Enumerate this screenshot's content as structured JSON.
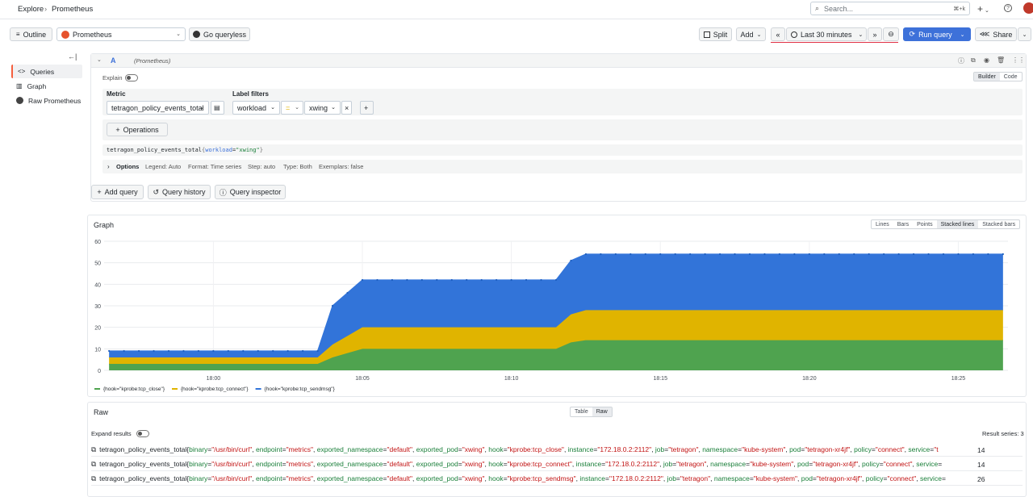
{
  "topbar": {
    "breadcrumb": [
      "Explore",
      "Prometheus"
    ],
    "crumb_sep": "›",
    "search_placeholder": "Search...",
    "search_shortcut": "⌘+k",
    "plus_label": "+",
    "help_icon": "help-icon"
  },
  "toolbar": {
    "outline_label": "Outline",
    "datasource": "Prometheus",
    "go_queryless_label": "Go queryless",
    "split_label": "Split",
    "add_label": "Add",
    "time_range": "Last 30 minutes",
    "run_query_label": "Run query",
    "share_label": "Share",
    "accent": "#3d71d9"
  },
  "sidebar": {
    "collapse_icon": "←|",
    "items": [
      {
        "label": "Queries",
        "icon": "code-icon",
        "active": true
      },
      {
        "label": "Graph",
        "icon": "graph-icon",
        "active": false
      },
      {
        "label": "Raw Prometheus",
        "icon": "prometheus-icon",
        "active": false
      }
    ]
  },
  "query": {
    "ref": "A",
    "datasource_hint": "(Prometheus)",
    "explain_label": "Explain",
    "mode_builder": "Builder",
    "mode_code": "Code",
    "metric_label": "Metric",
    "metric_value": "tetragon_policy_events_total",
    "label_filters_label": "Label filters",
    "filter_key": "workload",
    "filter_op": "=",
    "filter_value": "xwing",
    "operations_label": "Operations",
    "promql_metric": "tetragon_policy_events_total",
    "promql_open": "{",
    "promql_key": "workload",
    "promql_eq": "=",
    "promql_val": "\"xwing\"",
    "promql_close": "}",
    "options_label": "Options",
    "options": [
      "Legend: Auto",
      "Format: Time series",
      "Step: auto",
      "Type: Both",
      "Exemplars: false"
    ],
    "add_query_label": "Add query",
    "query_history_label": "Query history",
    "query_inspector_label": "Query inspector"
  },
  "graph": {
    "title": "Graph",
    "modes": [
      "Lines",
      "Bars",
      "Points",
      "Stacked lines",
      "Stacked bars"
    ],
    "active_mode": "Stacked lines"
  },
  "chart_data": {
    "type": "area",
    "stacked": true,
    "x": [
      "17:56:30",
      "17:57:00",
      "17:57:30",
      "17:58:00",
      "17:58:30",
      "17:59:00",
      "17:59:30",
      "18:00:00",
      "18:00:30",
      "18:01:00",
      "18:01:30",
      "18:02:00",
      "18:02:30",
      "18:03:00",
      "18:03:30",
      "18:04:00",
      "18:04:30",
      "18:05:00",
      "18:05:30",
      "18:06:00",
      "18:06:30",
      "18:07:00",
      "18:07:30",
      "18:08:00",
      "18:08:30",
      "18:09:00",
      "18:09:30",
      "18:10:00",
      "18:10:30",
      "18:11:00",
      "18:11:30",
      "18:12:00",
      "18:12:30",
      "18:13:00",
      "18:13:30",
      "18:14:00",
      "18:14:30",
      "18:15:00",
      "18:15:30",
      "18:16:00",
      "18:16:30",
      "18:17:00",
      "18:17:30",
      "18:18:00",
      "18:18:30",
      "18:19:00",
      "18:19:30",
      "18:20:00",
      "18:20:30",
      "18:21:00",
      "18:21:30",
      "18:22:00",
      "18:22:30",
      "18:23:00",
      "18:23:30",
      "18:24:00",
      "18:24:30",
      "18:25:00",
      "18:25:30",
      "18:26:00",
      "18:26:30"
    ],
    "series": [
      {
        "name": "{hook=\"kprobe:tcp_close\"}",
        "color": "#4fa34f",
        "values": [
          3,
          3,
          3,
          3,
          3,
          3,
          3,
          3,
          3,
          3,
          3,
          3,
          3,
          3,
          3,
          6,
          8,
          10,
          10,
          10,
          10,
          10,
          10,
          10,
          10,
          10,
          10,
          10,
          10,
          10,
          10,
          13,
          14,
          14,
          14,
          14,
          14,
          14,
          14,
          14,
          14,
          14,
          14,
          14,
          14,
          14,
          14,
          14,
          14,
          14,
          14,
          14,
          14,
          14,
          14,
          14,
          14,
          14,
          14,
          14,
          14
        ]
      },
      {
        "name": "{hook=\"kprobe:tcp_connect\"}",
        "color": "#e0b400",
        "values": [
          3,
          3,
          3,
          3,
          3,
          3,
          3,
          3,
          3,
          3,
          3,
          3,
          3,
          3,
          3,
          6,
          8,
          10,
          10,
          10,
          10,
          10,
          10,
          10,
          10,
          10,
          10,
          10,
          10,
          10,
          10,
          13,
          14,
          14,
          14,
          14,
          14,
          14,
          14,
          14,
          14,
          14,
          14,
          14,
          14,
          14,
          14,
          14,
          14,
          14,
          14,
          14,
          14,
          14,
          14,
          14,
          14,
          14,
          14,
          14,
          14
        ]
      },
      {
        "name": "{hook=\"kprobe:tcp_sendmsg\"}",
        "color": "#3274d9",
        "values": [
          3,
          3,
          3,
          3,
          3,
          3,
          3,
          3,
          3,
          3,
          3,
          3,
          3,
          3,
          3,
          18,
          20,
          22,
          22,
          22,
          22,
          22,
          22,
          22,
          22,
          22,
          22,
          22,
          22,
          22,
          22,
          25,
          26,
          26,
          26,
          26,
          26,
          26,
          26,
          26,
          26,
          26,
          26,
          26,
          26,
          26,
          26,
          26,
          26,
          26,
          26,
          26,
          26,
          26,
          26,
          26,
          26,
          26,
          26,
          26,
          26
        ]
      }
    ],
    "xticks": [
      "18:00",
      "18:05",
      "18:10",
      "18:15",
      "18:20",
      "18:25"
    ],
    "yticks": [
      0,
      10,
      20,
      30,
      40,
      50,
      60
    ],
    "ylim": [
      0,
      60
    ],
    "grid": true,
    "legend_position": "bottom-left"
  },
  "raw": {
    "title": "Raw",
    "view_table": "Table",
    "view_raw": "Raw",
    "expand_label": "Expand results",
    "result_count": "Result series: 3",
    "rows": [
      {
        "metric": "tetragon_policy_events_total",
        "labels": [
          [
            "binary",
            "\"/usr/bin/curl\""
          ],
          [
            "endpoint",
            "\"metrics\""
          ],
          [
            "exported_namespace",
            "\"default\""
          ],
          [
            "exported_pod",
            "\"xwing\""
          ],
          [
            "hook",
            "\"kprobe:tcp_close\""
          ],
          [
            "instance",
            "\"172.18.0.2:2112\""
          ],
          [
            "job",
            "\"tetragon\""
          ],
          [
            "namespace",
            "\"kube-system\""
          ],
          [
            "pod",
            "\"tetragon-xr4jf\""
          ],
          [
            "policy",
            "\"connect\""
          ],
          [
            "service",
            "\"t"
          ]
        ],
        "value": "14"
      },
      {
        "metric": "tetragon_policy_events_total",
        "labels": [
          [
            "binary",
            "\"/usr/bin/curl\""
          ],
          [
            "endpoint",
            "\"metrics\""
          ],
          [
            "exported_namespace",
            "\"default\""
          ],
          [
            "exported_pod",
            "\"xwing\""
          ],
          [
            "hook",
            "\"kprobe:tcp_connect\""
          ],
          [
            "instance",
            "\"172.18.0.2:2112\""
          ],
          [
            "job",
            "\"tetragon\""
          ],
          [
            "namespace",
            "\"kube-system\""
          ],
          [
            "pod",
            "\"tetragon-xr4jf\""
          ],
          [
            "policy",
            "\"connect\""
          ],
          [
            "service",
            ""
          ]
        ],
        "value": "14"
      },
      {
        "metric": "tetragon_policy_events_total",
        "labels": [
          [
            "binary",
            "\"/usr/bin/curl\""
          ],
          [
            "endpoint",
            "\"metrics\""
          ],
          [
            "exported_namespace",
            "\"default\""
          ],
          [
            "exported_pod",
            "\"xwing\""
          ],
          [
            "hook",
            "\"kprobe:tcp_sendmsg\""
          ],
          [
            "instance",
            "\"172.18.0.2:2112\""
          ],
          [
            "job",
            "\"tetragon\""
          ],
          [
            "namespace",
            "\"kube-system\""
          ],
          [
            "pod",
            "\"tetragon-xr4jf\""
          ],
          [
            "policy",
            "\"connect\""
          ],
          [
            "service",
            ""
          ]
        ],
        "value": "26"
      }
    ]
  }
}
